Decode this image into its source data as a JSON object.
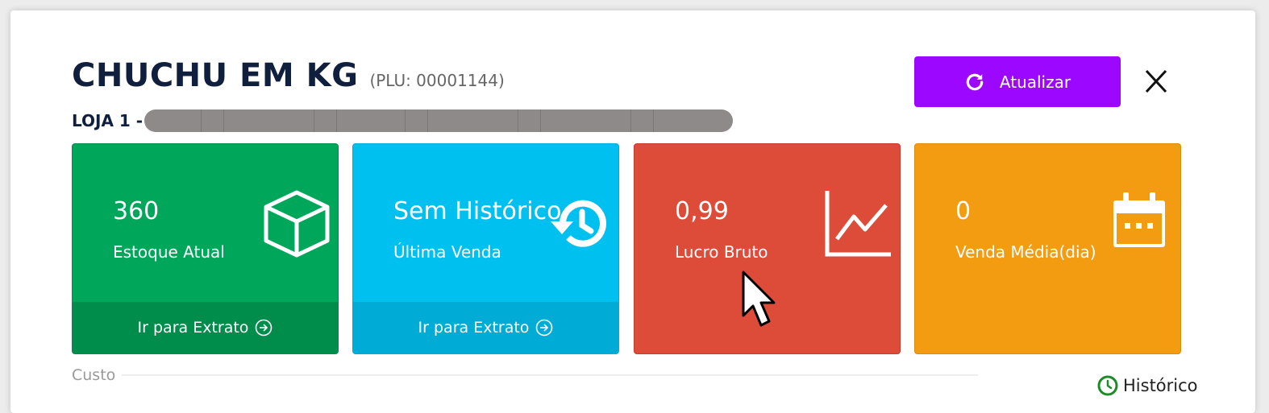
{
  "header": {
    "product_name": "CHUCHU EM KG",
    "plu": "(PLU: 00001144)",
    "store_label": "LOJA 1 -",
    "refresh_label": "Atualizar",
    "close_label": "X"
  },
  "cards": {
    "stock": {
      "value": "360",
      "label": "Estoque Atual",
      "footer": "Ir para Extrato",
      "icon": "cube-icon"
    },
    "last_sale": {
      "value": "Sem Histórico",
      "label": "Última Venda",
      "footer": "Ir para Extrato",
      "icon": "history-icon"
    },
    "gross_profit": {
      "value": "0,99",
      "label": "Lucro Bruto",
      "icon": "line-chart-icon"
    },
    "avg_sales": {
      "value": "0",
      "label": "Venda Média(dia)",
      "icon": "calendar-icon"
    }
  },
  "cost_section": {
    "label": "Custo",
    "history_link": "Histórico"
  },
  "colors": {
    "accent_button": "#9b07ff",
    "stock_card": "#00a65a",
    "last_sale_card": "#00c0ef",
    "gross_profit_card": "#dd4b39",
    "avg_sales_card": "#f39c12",
    "history_icon": "#1e8a28"
  }
}
